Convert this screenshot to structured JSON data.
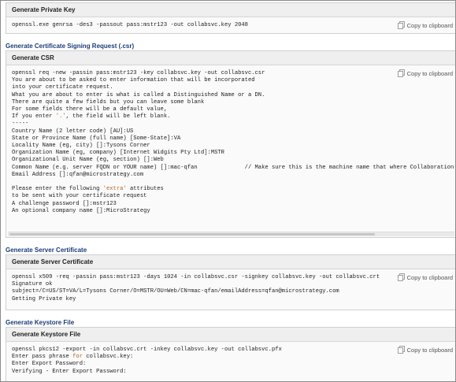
{
  "panels": {
    "private_key": {
      "title": "Generate Private Key",
      "copy_label": "Copy to clipboard",
      "lines": [
        "openssl.exe genrsa -des3 -passout pass:mstr123 -out collabsvc.key 2048"
      ]
    },
    "csr": {
      "section_title": "Generate Certificate Signing Request (.csr)",
      "title": "Generate CSR",
      "copy_label": "Copy to clipboard",
      "lines": [
        "openssl req -new -passin pass:mstr123 -key collabsvc.key -out collabsvc.csr",
        "You are about to be asked to enter information that will be incorporated",
        "into your certificate request.",
        "What you are about to enter is what is called a Distinguished Name or a DN.",
        "There are quite a few fields but you can leave some blank",
        "For some fields there will be a default value,",
        "If you enter '.', the field will be left blank.",
        "-----",
        "Country Name (2 letter code) [AU]:US",
        "State or Province Name (full name) [Some-State]:VA",
        "Locality Name (eg, city) []:Tysons Corner",
        "Organization Name (eg, company) [Internet Widgits Pty Ltd]:MSTR",
        "Organizational Unit Name (eg, section) []:Web",
        "Common Name (e.g. server FQDN or YOUR name) []:mac-qfan              // Make sure this is the machine name that where Collaboration",
        "Email Address []:qfan@microstrategy.com",
        "",
        "Please enter the following 'extra' attributes",
        "to be sent with your certificate request",
        "A challenge password []:mstr123",
        "An optional company name []:MicroStrategy"
      ]
    },
    "server_cert": {
      "section_title": "Generate Server Certificate",
      "title": "Generate Server Certificate",
      "copy_label": "Copy to clipboard",
      "lines": [
        "openssl x509 -req -passin pass:mstr123 -days 1024 -in collabsvc.csr -signkey collabsvc.key -out collabsvc.crt",
        "Signature ok",
        "subject=/C=US/ST=VA/L=Tysons Corner/O=MSTR/OU=Web/CN=mac-qfan/emailAddress=qfan@microstrategy.com",
        "Getting Private key"
      ]
    },
    "keystore": {
      "section_title": "Generate Keystore File",
      "title": "Generate Keystore File",
      "copy_label": "Copy to clipboard",
      "lines": [
        "openssl pkcs12 -export -in collabsvc.crt -inkey collabsvc.key -out collabsvc.pfx",
        "Enter pass phrase for collabsvc.key:",
        "Enter Export Password:",
        "Verifying - Enter Export Password:"
      ]
    }
  },
  "colors": {
    "section_title": "#1b3d78",
    "string_literal": "#b5651d",
    "keyword": "#b5651d"
  }
}
